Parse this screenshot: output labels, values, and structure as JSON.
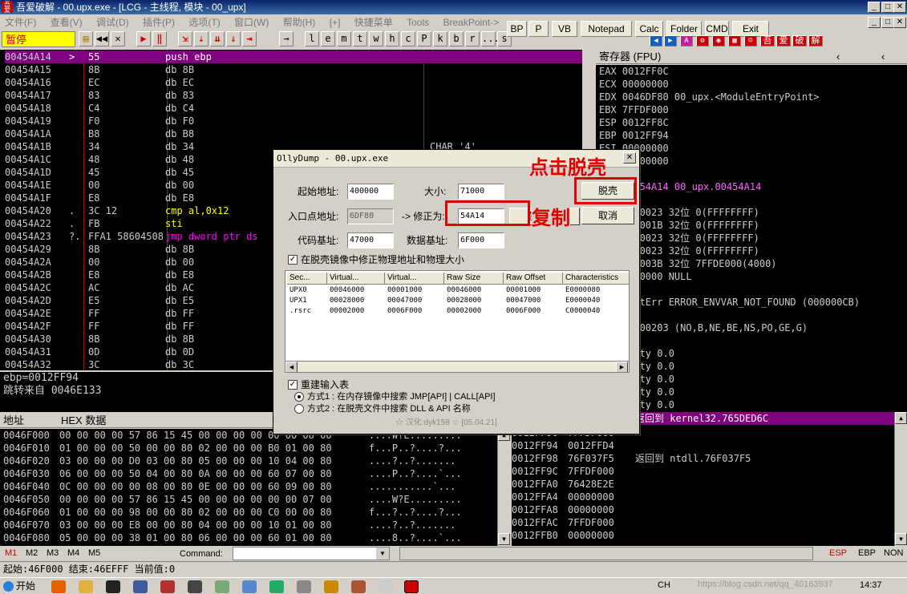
{
  "window": {
    "title": "吾爱破解 - 00.upx.exe - [LCG - 主线程, 模块 - 00_upx]",
    "icon_text": "吾爱"
  },
  "menu": [
    "文件(F)",
    "查看(V)",
    "调试(D)",
    "插件(P)",
    "选项(T)",
    "窗口(W)",
    "帮助(H)",
    "[+]",
    "快捷菜单",
    "Tools",
    "BreakPoint->"
  ],
  "toolbar": {
    "status": "暂停",
    "letters": [
      "l",
      "e",
      "m",
      "t",
      "w",
      "h",
      "c",
      "P",
      "k",
      "b",
      "r",
      "...",
      "s"
    ],
    "plugin_buttons": [
      "BP",
      "P",
      "VB",
      "Notepad",
      "Calc",
      "Folder",
      "CMD",
      "Exit"
    ],
    "right_glyphs": [
      "吾",
      "爱",
      "破",
      "解"
    ]
  },
  "disasm": {
    "rows": [
      {
        "addr": "00454A14",
        "mark": ">",
        "hex": "55",
        "dis": "push ebp",
        "com": ""
      },
      {
        "addr": "00454A15",
        "mark": "",
        "hex": "8B",
        "dis": "db 8B",
        "com": ""
      },
      {
        "addr": "00454A16",
        "mark": "",
        "hex": "EC",
        "dis": "db EC",
        "com": ""
      },
      {
        "addr": "00454A17",
        "mark": "",
        "hex": "83",
        "dis": "db 83",
        "com": ""
      },
      {
        "addr": "00454A18",
        "mark": "",
        "hex": "C4",
        "dis": "db C4",
        "com": ""
      },
      {
        "addr": "00454A19",
        "mark": "",
        "hex": "F0",
        "dis": "db F0",
        "com": ""
      },
      {
        "addr": "00454A1A",
        "mark": "",
        "hex": "B8",
        "dis": "db B8",
        "com": ""
      },
      {
        "addr": "00454A1B",
        "mark": "",
        "hex": "34",
        "dis": "db 34",
        "com": "CHAR '4'"
      },
      {
        "addr": "00454A1C",
        "mark": "",
        "hex": "48",
        "dis": "db 48",
        "com": ""
      },
      {
        "addr": "00454A1D",
        "mark": "",
        "hex": "45",
        "dis": "db 45",
        "com": ""
      },
      {
        "addr": "00454A1E",
        "mark": "",
        "hex": "00",
        "dis": "db 00",
        "com": ""
      },
      {
        "addr": "00454A1F",
        "mark": "",
        "hex": "E8",
        "dis": "db E8",
        "com": ""
      },
      {
        "addr": "00454A20",
        "mark": ".",
        "hex": "3C 12",
        "dis": "cmp al,0x12",
        "com": ""
      },
      {
        "addr": "00454A22",
        "mark": ".",
        "hex": "FB",
        "dis": "sti",
        "com": ""
      },
      {
        "addr": "00454A23",
        "mark": "?.",
        "hex": "FFA1 58604508",
        "dis": "jmp dword ptr ds",
        "com": ""
      },
      {
        "addr": "00454A29",
        "mark": "",
        "hex": "8B",
        "dis": "db 8B",
        "com": ""
      },
      {
        "addr": "00454A2A",
        "mark": "",
        "hex": "00",
        "dis": "db 00",
        "com": ""
      },
      {
        "addr": "00454A2B",
        "mark": "",
        "hex": "E8",
        "dis": "db E8",
        "com": ""
      },
      {
        "addr": "00454A2C",
        "mark": "",
        "hex": "AC",
        "dis": "db AC",
        "com": ""
      },
      {
        "addr": "00454A2D",
        "mark": "",
        "hex": "E5",
        "dis": "db E5",
        "com": ""
      },
      {
        "addr": "00454A2E",
        "mark": "",
        "hex": "FF",
        "dis": "db FF",
        "com": ""
      },
      {
        "addr": "00454A2F",
        "mark": "",
        "hex": "FF",
        "dis": "db FF",
        "com": ""
      },
      {
        "addr": "00454A30",
        "mark": "",
        "hex": "8B",
        "dis": "db 8B",
        "com": ""
      },
      {
        "addr": "00454A31",
        "mark": "",
        "hex": "0D",
        "dis": "db 0D",
        "com": ""
      },
      {
        "addr": "00454A32",
        "mark": "",
        "hex": "3C",
        "dis": "db 3C",
        "com": ""
      }
    ],
    "info_line1": "ebp=0012FF94",
    "info_line2": "跳转来自 0046E133"
  },
  "registers": {
    "header": "寄存器 (FPU)",
    "rows": [
      "EAX 0012FF0C",
      "ECX 00000000",
      "EDX 0046DF80 00_upx.<ModuleEntryPoint>",
      "EBX 7FFDF000",
      "ESP 0012FF8C",
      "EBP 0012FF94",
      "ESI 00000000",
      "EDI 00000000",
      "",
      "EIP 00454A14 00_upx.00454A14",
      "",
      "C 0 ES 0023 32位 0(FFFFFFFF)",
      "P 1 CS 001B 32位 0(FFFFFFFF)",
      "A 0 SS 0023 32位 0(FFFFFFFF)",
      "Z 1 DS 0023 32位 0(FFFFFFFF)",
      "S 0 FS 003B 32位 7FFDE000(4000)",
      "T 0 GS 0000 NULL",
      "D 0",
      "O 0 LastErr ERROR_ENVVAR_NOT_FOUND (000000CB)",
      "",
      "EFL 00000203 (NO,B,NE,BE,NS,PO,GE,G)",
      "",
      "ST0 empty 0.0",
      "ST1 empty 0.0",
      "ST2 empty 0.0",
      "ST3 empty 0.0",
      "ST4 empty 0.0",
      "ST5 empty 0.0",
      "ST6 empty 0.0",
      "ST7 empty 0.0"
    ]
  },
  "dump": {
    "header_addr": "地址",
    "header_hex": "HEX 数据",
    "rows": [
      {
        "addr": "0046F000",
        "hex": "00 00 00 00 57 86 15 45 00 00 00 00 00 00 08 00",
        "asc": "....W?E........."
      },
      {
        "addr": "0046F010",
        "hex": "01 00 00 00 50 00 00 80 02 00 00 00 B0 01 00 80",
        "asc": "f...P..?....?..."
      },
      {
        "addr": "0046F020",
        "hex": "03 00 00 00 D0 03 00 80 05 00 00 00 10 04 00 80",
        "asc": "....?..?......."
      },
      {
        "addr": "0046F030",
        "hex": "06 00 00 00 50 04 00 80 0A 00 00 00 60 07 00 80",
        "asc": "....P..?....`..."
      },
      {
        "addr": "0046F040",
        "hex": "0C 00 00 00 00 08 00 80 0E 00 00 00 60 09 00 80",
        "asc": "...........`..."
      },
      {
        "addr": "0046F050",
        "hex": "00 00 00 00 57 86 15 45 00 00 00 00 00 00 07 00",
        "asc": "....W?E........."
      },
      {
        "addr": "0046F060",
        "hex": "01 00 00 00 98 00 00 80 02 00 00 00 C0 00 00 80",
        "asc": "f...?..?....?..."
      },
      {
        "addr": "0046F070",
        "hex": "03 00 00 00 E8 00 00 80 04 00 00 00 10 01 00 80",
        "asc": "....?..?......."
      },
      {
        "addr": "0046F080",
        "hex": "05 00 00 00 38 01 00 80 06 00 00 00 60 01 00 80",
        "asc": "....8..?....`..."
      }
    ]
  },
  "stack": {
    "top_row": "返回到 kernel32.765DED6C",
    "rows": [
      {
        "addr": "0012FF90",
        "val": "7FFDF000",
        "com": ""
      },
      {
        "addr": "0012FF94",
        "val": "0012FFD4",
        "com": ""
      },
      {
        "addr": "0012FF98",
        "val": "76F037F5",
        "com": "返回到 ntdll.76F037F5"
      },
      {
        "addr": "0012FF9C",
        "val": "7FFDF000",
        "com": ""
      },
      {
        "addr": "0012FFA0",
        "val": "76428E2E",
        "com": ""
      },
      {
        "addr": "0012FFA4",
        "val": "00000000",
        "com": ""
      },
      {
        "addr": "0012FFA8",
        "val": "00000000",
        "com": ""
      },
      {
        "addr": "0012FFAC",
        "val": "7FFDF000",
        "com": ""
      },
      {
        "addr": "0012FFB0",
        "val": "00000000",
        "com": ""
      }
    ]
  },
  "dialog": {
    "title": "OllyDump - 00.upx.exe",
    "start_label": "起始地址:",
    "start_value": "400000",
    "size_label": "大小:",
    "size_value": "71000",
    "entry_label": "入口点地址:",
    "entry_value": "6DF80",
    "fix_label": "-> 修正为:",
    "fix_value": "54A14",
    "get_eip_button": "获取EIP",
    "code_base_label": "代码基址:",
    "code_base_value": "47000",
    "data_base_label": "数据基址:",
    "data_base_value": "6F000",
    "fix_raw_checkbox": "在脱壳镜像中修正物理地址和物理大小",
    "dump_button": "脱壳",
    "cancel_button": "取消",
    "columns": [
      "Sec...",
      "Virtual...",
      "Virtual...",
      "Raw Size",
      "Raw Offset",
      "Characteristics"
    ],
    "sections": [
      [
        "UPX0",
        "00046000",
        "00001000",
        "00046000",
        "00001000",
        "E0000080"
      ],
      [
        "UPX1",
        "00028000",
        "00047000",
        "00028000",
        "00047000",
        "E0000040"
      ],
      [
        ".rsrc",
        "00002000",
        "0006F000",
        "00002000",
        "0006F000",
        "C0000040"
      ]
    ],
    "rebuild_checkbox": "重建输入表",
    "method1": "方式1 : 在内存镜像中搜索 JMP[API] | CALL[API]",
    "method2": "方式2 : 在脱壳文件中搜索 DLL & API 名称",
    "credit": "☆ 汉化:dyk158 ☆ [05.04.21]"
  },
  "annotations": {
    "click_dump": "点击脱壳",
    "copy": "复制"
  },
  "cmdbar": {
    "tabs": [
      "M1",
      "M2",
      "M3",
      "M4",
      "M5"
    ],
    "command_label": "Command:",
    "right_items": [
      "ESP",
      "EBP",
      "NON"
    ]
  },
  "status": {
    "text": "起始:46F000 结束:46EFFF 当前值:0"
  },
  "taskbar": {
    "start": "开始",
    "lang": "CH",
    "clock": "14:37",
    "watermark": "https://blog.csdn.net/qq_40163937"
  },
  "colors": {
    "selection": "#800080",
    "annotation": "#e00000",
    "status_bg": "#ffff00"
  }
}
